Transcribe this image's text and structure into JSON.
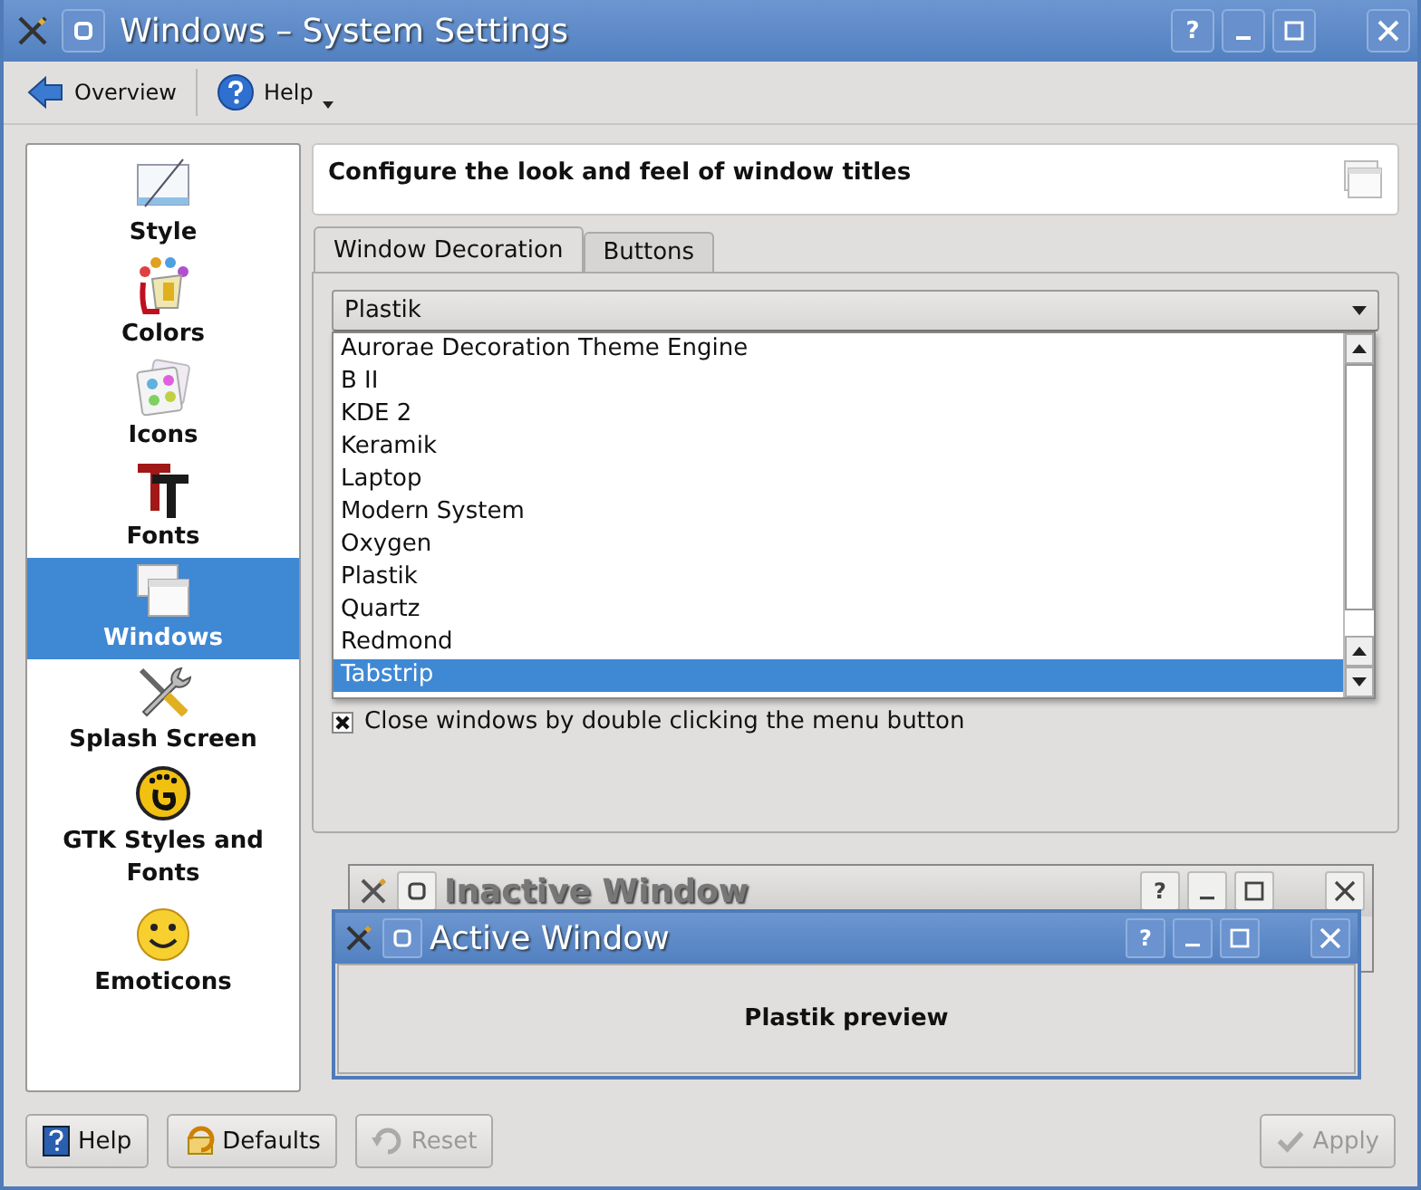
{
  "window": {
    "title": "Windows – System Settings",
    "help_button": "?"
  },
  "toolbar": [
    {
      "label": "Overview",
      "kind": "back",
      "menu": false
    },
    {
      "label": "Help",
      "kind": "help",
      "menu": true
    }
  ],
  "sidebar": {
    "items": [
      {
        "label": "Style",
        "selected": false
      },
      {
        "label": "Colors",
        "selected": false
      },
      {
        "label": "Icons",
        "selected": false
      },
      {
        "label": "Fonts",
        "selected": false
      },
      {
        "label": "Windows",
        "selected": true
      },
      {
        "label": "Splash Screen",
        "selected": false
      },
      {
        "label": "GTK Styles and Fonts",
        "selected": false
      },
      {
        "label": "Emoticons",
        "selected": false
      }
    ]
  },
  "header": {
    "text": "Configure the look and feel of window titles"
  },
  "tabs": [
    {
      "label": "Window Decoration",
      "selected": true
    },
    {
      "label": "Buttons",
      "selected": false
    }
  ],
  "decoration_combo": {
    "value": "Plastik",
    "expanded": true
  },
  "dropdown": {
    "items": [
      {
        "label": "Aurorae Decoration Theme Engine",
        "selected": false
      },
      {
        "label": "B II",
        "selected": false
      },
      {
        "label": "KDE 2",
        "selected": false
      },
      {
        "label": "Keramik",
        "selected": false
      },
      {
        "label": "Laptop",
        "selected": false
      },
      {
        "label": "Modern System",
        "selected": false
      },
      {
        "label": "Oxygen",
        "selected": false
      },
      {
        "label": "Plastik",
        "selected": false
      },
      {
        "label": "Quartz",
        "selected": false
      },
      {
        "label": "Redmond",
        "selected": false
      },
      {
        "label": "Tabstrip",
        "selected": true
      }
    ]
  },
  "options": [
    {
      "label": "Close windows by double clicking the menu button",
      "checked": true
    }
  ],
  "preview": {
    "inactive_title": "Inactive Window",
    "active_title": "Active Window",
    "help_button": "?",
    "text": "Plastik preview"
  },
  "buttons": [
    {
      "label": "Help",
      "kind": "help",
      "disabled": false
    },
    {
      "label": "Defaults",
      "kind": "defaults",
      "disabled": false
    },
    {
      "label": "Reset",
      "kind": "reset",
      "disabled": true
    },
    {
      "label": "Apply",
      "kind": "apply",
      "disabled": true
    }
  ]
}
